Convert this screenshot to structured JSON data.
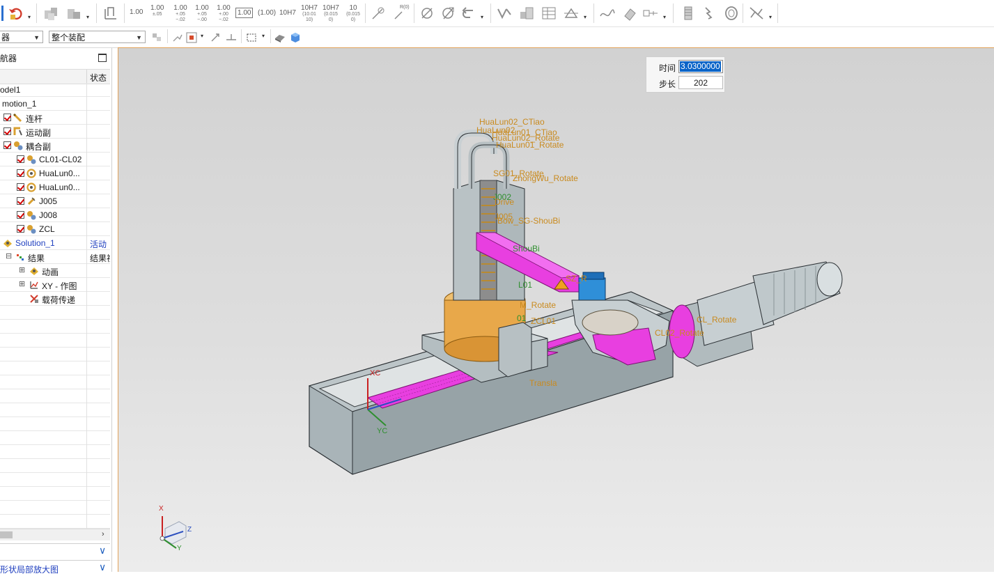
{
  "toolbar": {
    "tolerances": [
      {
        "main": "1.00",
        "sub": ""
      },
      {
        "main": "1.00",
        "sub": "±.05"
      },
      {
        "main": "1.00",
        "sub": "+.05 −.02"
      },
      {
        "main": "1.00",
        "sub": "+.05 −.00"
      },
      {
        "main": "1.00",
        "sub": "+.00 −.02"
      }
    ],
    "tol_boxed": "1.00",
    "tol_paren": "(1.00)",
    "fit_plain": "10H7",
    "fit_a": {
      "main": "10H7",
      "sub": "(10.01 10)"
    },
    "fit_b": {
      "main": "10H7",
      "sub": "(0.015 0)"
    },
    "fit_c": {
      "main": "10",
      "sub": "(0.015 0)"
    },
    "r_label": "R(0)"
  },
  "filters": {
    "type_filter": "器",
    "scope_filter": "整个装配"
  },
  "navigator": {
    "title": "航器",
    "col_status": "状态",
    "rows": [
      {
        "label": "odel1",
        "status": ""
      },
      {
        "label": "motion_1",
        "status": ""
      },
      {
        "label": "连杆",
        "status": ""
      },
      {
        "label": "运动副",
        "status": ""
      },
      {
        "label": "耦合副",
        "status": ""
      },
      {
        "label": "CL01-CL02",
        "status": ""
      },
      {
        "label": "HuaLun0...",
        "status": ""
      },
      {
        "label": "HuaLun0...",
        "status": ""
      },
      {
        "label": "J005",
        "status": ""
      },
      {
        "label": "J008",
        "status": ""
      },
      {
        "label": "ZCL",
        "status": ""
      },
      {
        "label": "Solution_1",
        "status": "活动"
      },
      {
        "label": "结果",
        "status": "结果视"
      },
      {
        "label": "动画",
        "status": ""
      },
      {
        "label": "XY - 作图",
        "status": ""
      },
      {
        "label": "载荷传递",
        "status": ""
      }
    ],
    "panel_preview": "",
    "panel_bottom": "形状局部放大图"
  },
  "animation": {
    "time_label": "时间",
    "time_value": "3.0300000",
    "step_label": "步长",
    "step_value": "202"
  },
  "scene_labels": [
    {
      "text": "HuaLun02_CTiao",
      "tone": "orange"
    },
    {
      "text": "HuaLun02",
      "tone": "orange"
    },
    {
      "text": "HuaLun01_CTiao",
      "tone": "orange"
    },
    {
      "text": "HuaLun02_Rotate",
      "tone": "orange"
    },
    {
      "text": "HuaLun01_Rotate",
      "tone": "orange"
    },
    {
      "text": "SG01_Rotate",
      "tone": "orange"
    },
    {
      "text": "ZhongWu_Rotate",
      "tone": "orange"
    },
    {
      "text": "J002",
      "tone": "green"
    },
    {
      "text": "Drive",
      "tone": "orange"
    },
    {
      "text": "J005",
      "tone": "orange"
    },
    {
      "text": "Bow_SG-ShouBi",
      "tone": "orange"
    },
    {
      "text": "ShouBi",
      "tone": "green"
    },
    {
      "text": "SZ_R",
      "tone": "orange"
    },
    {
      "text": "L01",
      "tone": "green"
    },
    {
      "text": "M_Rotate",
      "tone": "orange"
    },
    {
      "text": "01",
      "tone": "green"
    },
    {
      "text": "ZCL01",
      "tone": "orange"
    },
    {
      "text": "CL_Rotate",
      "tone": "orange"
    },
    {
      "text": "CL02_Rotate",
      "tone": "orange"
    },
    {
      "text": "Transla",
      "tone": "orange"
    },
    {
      "text": "XC",
      "tone": "red"
    },
    {
      "text": "YC",
      "tone": "green"
    },
    {
      "text": "X",
      "tone": "red"
    },
    {
      "text": "Z",
      "tone": "blue"
    },
    {
      "text": "Y",
      "tone": "green"
    }
  ],
  "colors": {
    "magenta_part": "#e83fe0",
    "steel_part": "#a9b4b8",
    "brass_part": "#e0a040",
    "viewport_border": "#e2a25a",
    "selection_blue": "#0a64c8"
  }
}
